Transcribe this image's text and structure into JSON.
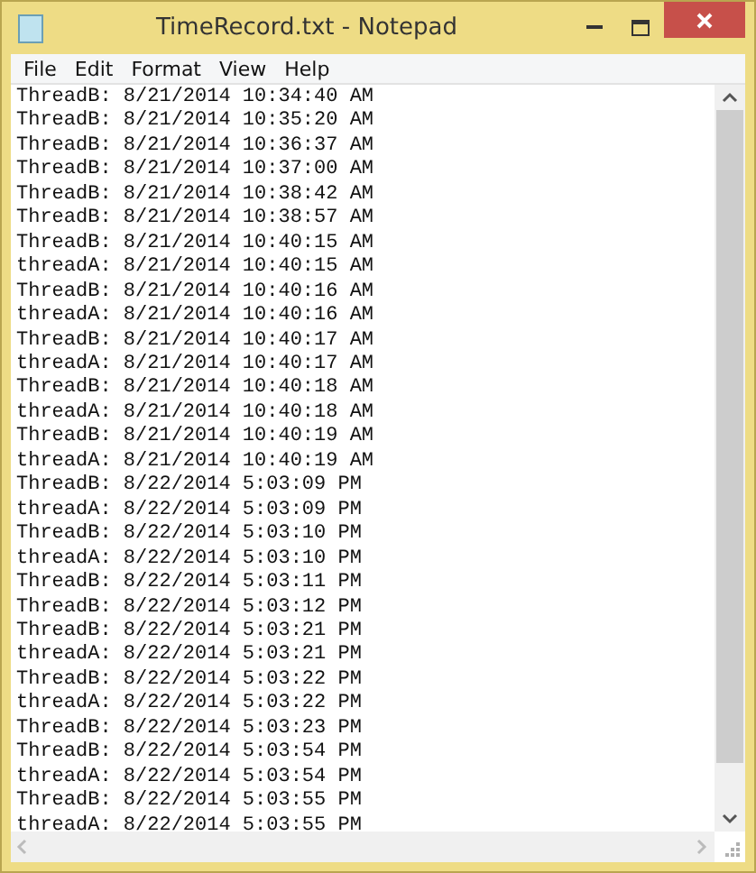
{
  "window": {
    "title": "TimeRecord.txt - Notepad"
  },
  "menu": [
    "File",
    "Edit",
    "Format",
    "View",
    "Help"
  ],
  "lines": [
    "ThreadB: 8/21/2014 10:34:40 AM",
    "ThreadB: 8/21/2014 10:35:20 AM",
    "ThreadB: 8/21/2014 10:36:37 AM",
    "ThreadB: 8/21/2014 10:37:00 AM",
    "ThreadB: 8/21/2014 10:38:42 AM",
    "ThreadB: 8/21/2014 10:38:57 AM",
    "ThreadB: 8/21/2014 10:40:15 AM",
    "threadA: 8/21/2014 10:40:15 AM",
    "ThreadB: 8/21/2014 10:40:16 AM",
    "threadA: 8/21/2014 10:40:16 AM",
    "ThreadB: 8/21/2014 10:40:17 AM",
    "threadA: 8/21/2014 10:40:17 AM",
    "ThreadB: 8/21/2014 10:40:18 AM",
    "threadA: 8/21/2014 10:40:18 AM",
    "ThreadB: 8/21/2014 10:40:19 AM",
    "threadA: 8/21/2014 10:40:19 AM",
    "ThreadB: 8/22/2014 5:03:09 PM",
    "threadA: 8/22/2014 5:03:09 PM",
    "ThreadB: 8/22/2014 5:03:10 PM",
    "threadA: 8/22/2014 5:03:10 PM",
    "ThreadB: 8/22/2014 5:03:11 PM",
    "ThreadB: 8/22/2014 5:03:12 PM",
    "ThreadB: 8/22/2014 5:03:21 PM",
    "threadA: 8/22/2014 5:03:21 PM",
    "ThreadB: 8/22/2014 5:03:22 PM",
    "threadA: 8/22/2014 5:03:22 PM",
    "ThreadB: 8/22/2014 5:03:23 PM",
    "ThreadB: 8/22/2014 5:03:54 PM",
    "threadA: 8/22/2014 5:03:54 PM",
    "ThreadB: 8/22/2014 5:03:55 PM",
    "threadA: 8/22/2014 5:03:55 PM"
  ]
}
